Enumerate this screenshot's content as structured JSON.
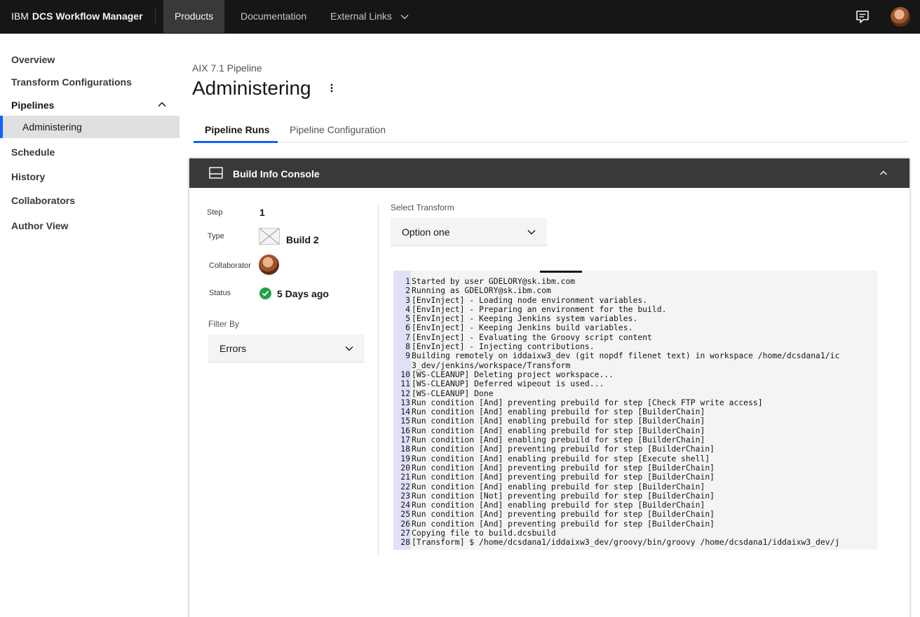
{
  "header": {
    "brand_prefix": "IBM",
    "brand_name": "DCS Workflow Manager",
    "nav": [
      "Products",
      "Documentation",
      "External Links"
    ]
  },
  "sidebar": {
    "items": [
      "Overview",
      "Transform Configurations",
      "Pipelines",
      "Schedule",
      "History",
      "Collaborators",
      "Author View"
    ],
    "sub_item": "Administering"
  },
  "page": {
    "eyebrow": "AIX 7.1 Pipeline",
    "title": "Administering"
  },
  "tabs": [
    "Pipeline Runs",
    "Pipeline Configuration"
  ],
  "card": {
    "title": "Build Info Console",
    "step_label": "Step",
    "step_value": "1",
    "type_label": "Type",
    "type_value": "Build 2",
    "collaborator_label": "Collaborator",
    "status_label": "Status",
    "status_value": "5 Days ago",
    "filter_label": "Filter By",
    "filter_value": "Errors",
    "transform_label": "Select Transform",
    "transform_value": "Option one"
  },
  "console": {
    "lines": [
      {
        "n": "1",
        "t": "Started by user GDELORY@sk.ibm.com"
      },
      {
        "n": "2",
        "t": "Running as GDELORY@sk.ibm.com"
      },
      {
        "n": "3",
        "t": "[EnvInject] - Loading node environment variables."
      },
      {
        "n": "4",
        "t": "[EnvInject] - Preparing an environment for the build."
      },
      {
        "n": "5",
        "t": "[EnvInject] - Keeping Jenkins system variables."
      },
      {
        "n": "6",
        "t": "[EnvInject] - Keeping Jenkins build variables."
      },
      {
        "n": "7",
        "t": "[EnvInject] - Evaluating the Groovy script content"
      },
      {
        "n": "8",
        "t": "[EnvInject] - Injecting contributions."
      },
      {
        "n": "9",
        "t": "Building remotely on iddaixw3_dev (git nopdf filenet text) in workspace /home/dcsdana1/ic"
      },
      {
        "n": "",
        "t": "3_dev/jenkins/workspace/Transform"
      },
      {
        "n": "10",
        "t": "[WS-CLEANUP] Deleting project workspace..."
      },
      {
        "n": "11",
        "t": "[WS-CLEANUP] Deferred wipeout is used..."
      },
      {
        "n": "12",
        "t": "[WS-CLEANUP] Done"
      },
      {
        "n": "13",
        "t": "Run condition [And] preventing prebuild for step [Check FTP write access]"
      },
      {
        "n": "14",
        "t": "Run condition [And] enabling prebuild for step [BuilderChain]"
      },
      {
        "n": "15",
        "t": "Run condition [And] enabling prebuild for step [BuilderChain]"
      },
      {
        "n": "16",
        "t": "Run condition [And] enabling prebuild for step [BuilderChain]"
      },
      {
        "n": "17",
        "t": "Run condition [And] enabling prebuild for step [BuilderChain]"
      },
      {
        "n": "18",
        "t": "Run condition [And] preventing prebuild for step [BuilderChain]"
      },
      {
        "n": "19",
        "t": "Run condition [And] enabling prebuild for step [Execute shell]"
      },
      {
        "n": "20",
        "t": "Run condition [And] preventing prebuild for step [BuilderChain]"
      },
      {
        "n": "21",
        "t": "Run condition [And] preventing prebuild for step [BuilderChain]"
      },
      {
        "n": "22",
        "t": "Run condition [And] enabling prebuild for step [BuilderChain]"
      },
      {
        "n": "23",
        "t": "Run condition [Not] preventing prebuild for step [BuilderChain]"
      },
      {
        "n": "24",
        "t": "Run condition [And] enabling prebuild for step [BuilderChain]"
      },
      {
        "n": "25",
        "t": "Run condition [And] preventing prebuild for step [BuilderChain]"
      },
      {
        "n": "26",
        "t": "Run condition [And] preventing prebuild for step [BuilderChain]"
      },
      {
        "n": "27",
        "t": "Copying file to build.dcsbuild"
      },
      {
        "n": "28",
        "t": "[Transform] $ /home/dcsdana1/iddaixw3_dev/groovy/bin/groovy /home/dcsdana1/iddaixw3_dev/j"
      }
    ]
  },
  "colors": {
    "header_bg": "#161616",
    "accent": "#0f62fe",
    "success": "#24a148",
    "card_header": "#393939"
  }
}
